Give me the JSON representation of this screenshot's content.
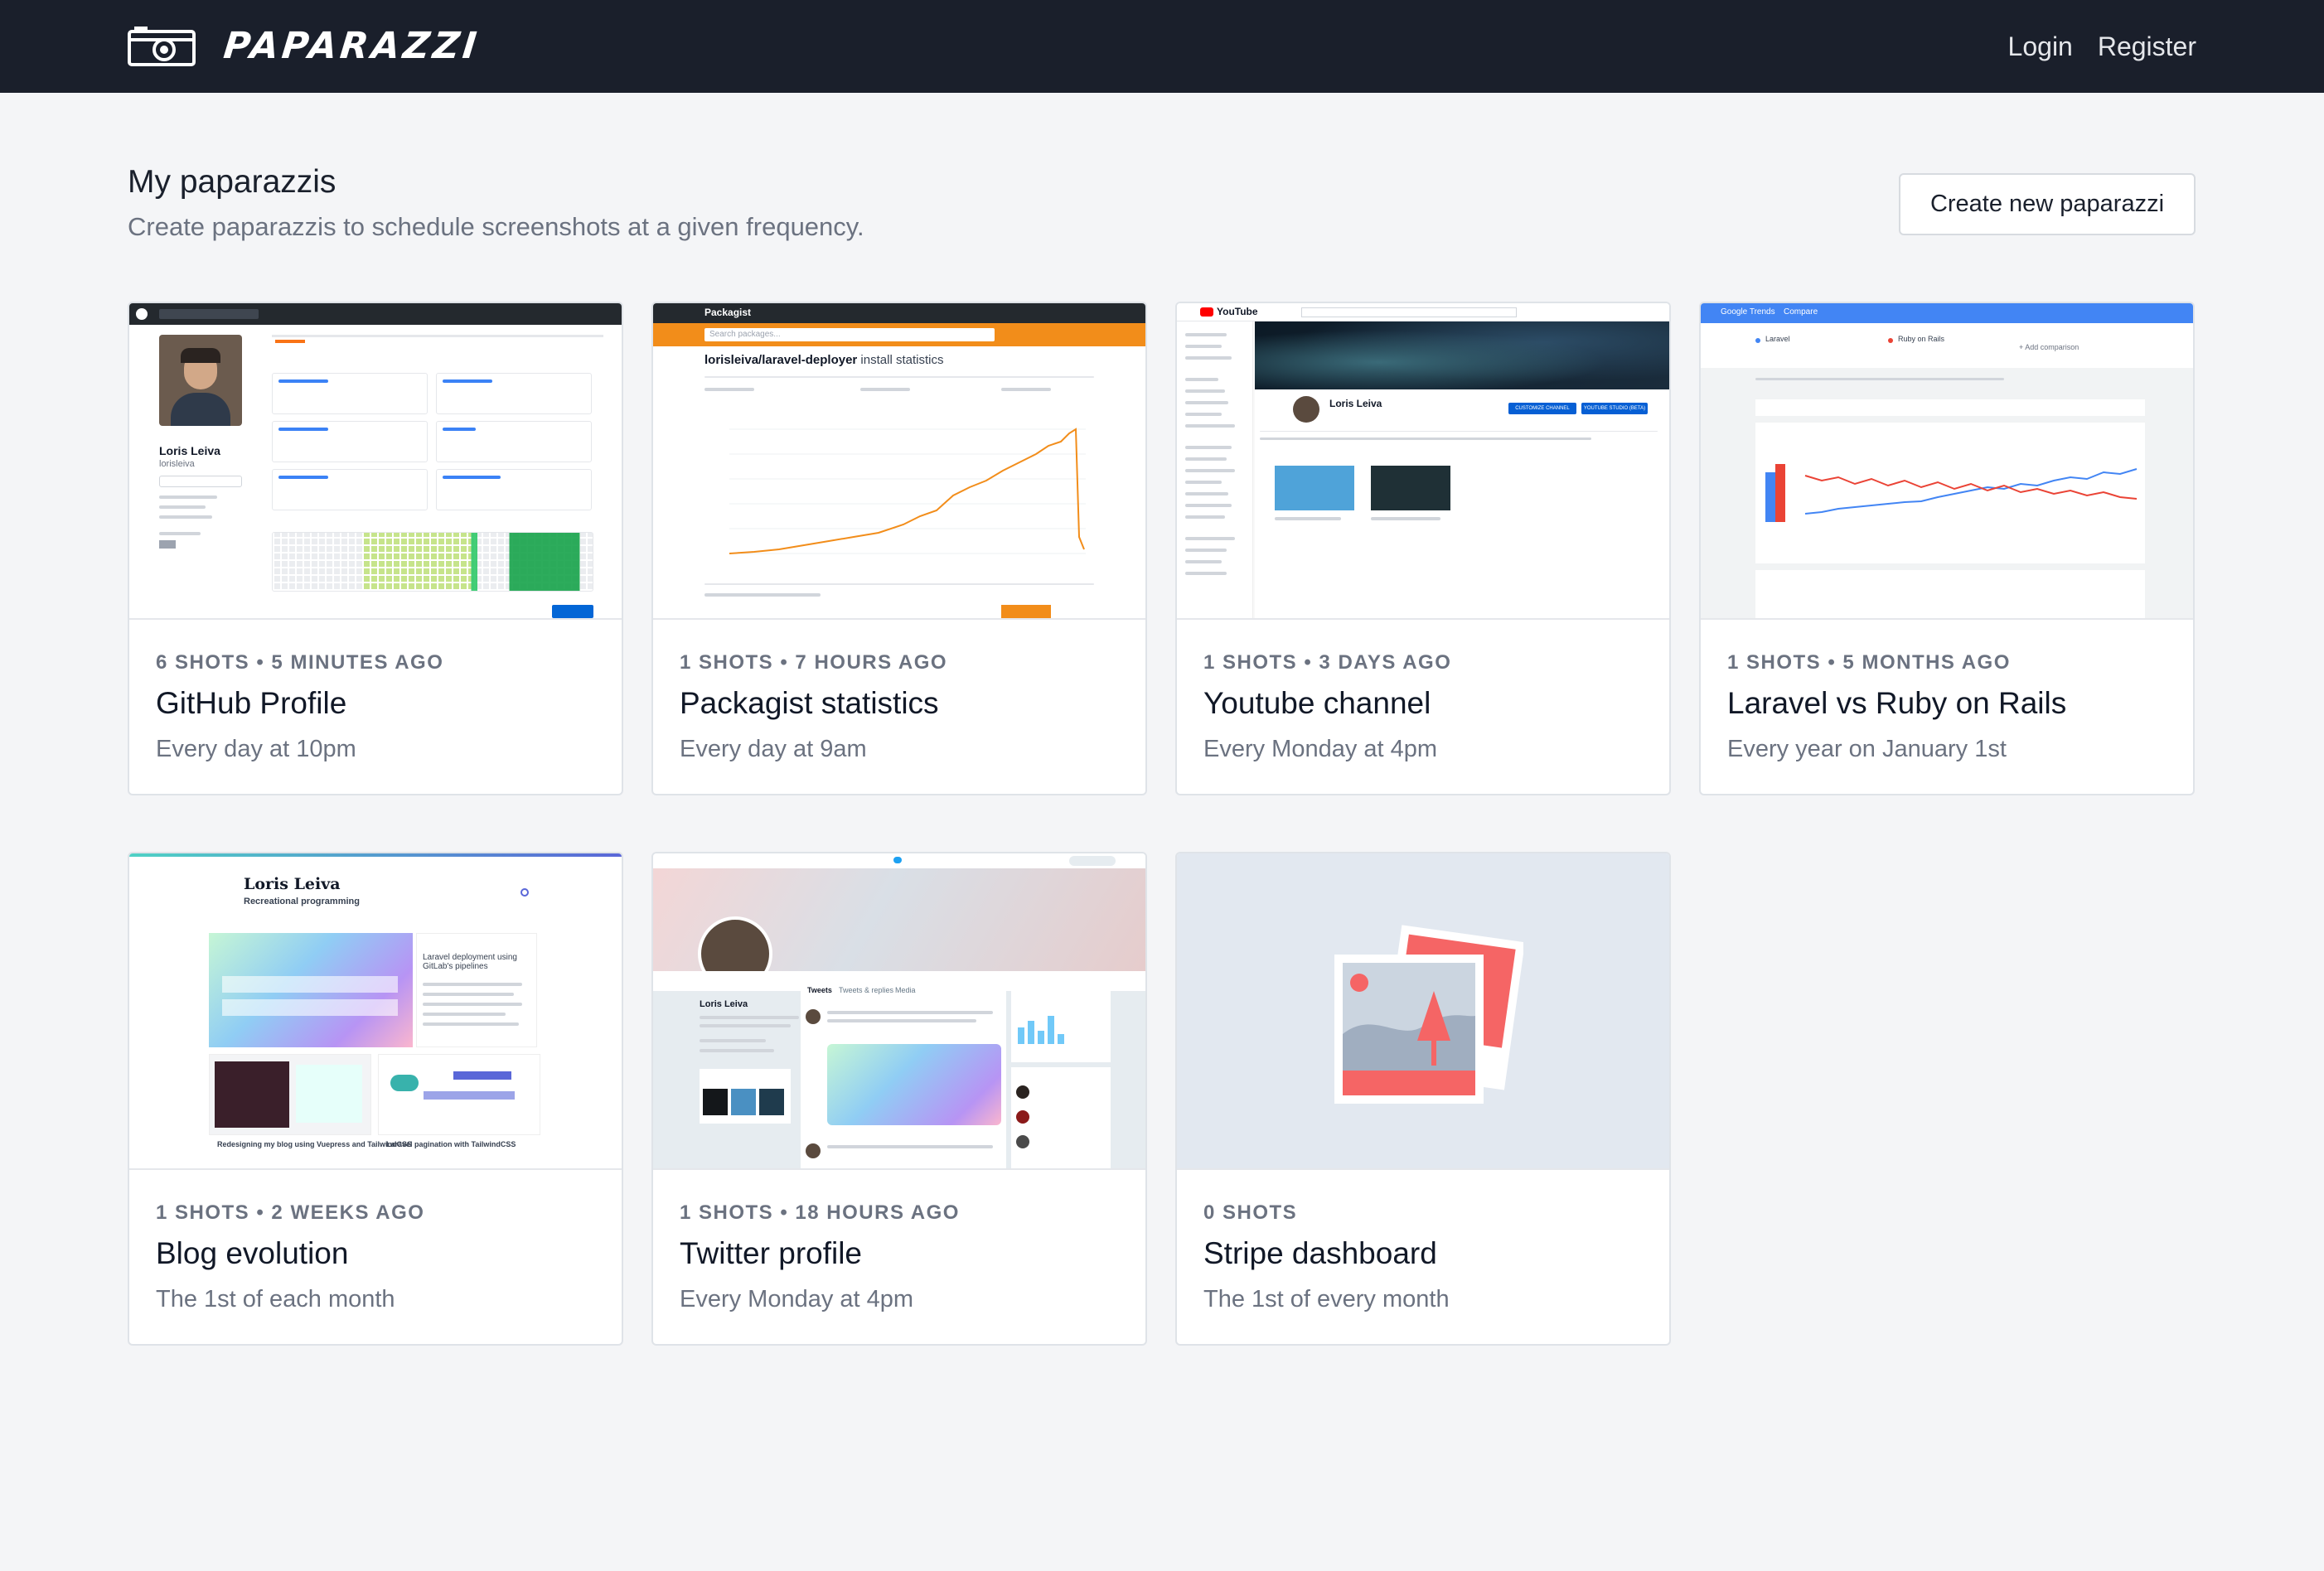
{
  "header": {
    "app_name": "PAPARAZZI",
    "logo_icon": "camera-icon",
    "nav": {
      "login": "Login",
      "register": "Register"
    },
    "background": "#1a1f2b"
  },
  "page": {
    "title": "My paparazzis",
    "subtitle": "Create paparazzis to schedule screenshots at a given frequency.",
    "create_button": "Create new paparazzi"
  },
  "cards": [
    {
      "meta": "6 SHOTS • 5 MINUTES AGO",
      "title": "GitHub Profile",
      "frequency": "Every day at 10pm"
    },
    {
      "meta": "1 SHOTS • 7 HOURS AGO",
      "title": "Packagist statistics",
      "frequency": "Every day at 9am"
    },
    {
      "meta": "1 SHOTS • 3 DAYS AGO",
      "title": "Youtube channel",
      "frequency": "Every Monday at 4pm"
    },
    {
      "meta": "1 SHOTS • 5 MONTHS AGO",
      "title": "Laravel vs Ruby on Rails",
      "frequency": "Every year on January 1st"
    },
    {
      "meta": "1 SHOTS • 2 WEEKS AGO",
      "title": "Blog evolution",
      "frequency": "The 1st of each month"
    },
    {
      "meta": "1 SHOTS • 18 HOURS AGO",
      "title": "Twitter profile",
      "frequency": "Every Monday at 4pm"
    },
    {
      "meta": "0 SHOTS",
      "title": "Stripe dashboard",
      "frequency": "The 1st of every month"
    }
  ],
  "thumbnails": {
    "github": {
      "name": "Loris Leiva",
      "handle": "lorisleiva"
    },
    "packagist": {
      "brand": "Packagist",
      "repo": "lorisleiva/laravel-deployer",
      "suffix": " install statistics",
      "search_placeholder": "Search packages..."
    },
    "youtube": {
      "brand": "YouTube",
      "channel": "Loris Leiva",
      "customize": "CUSTOMIZE CHANNEL",
      "studio": "YOUTUBE STUDIO (BETA)"
    },
    "trends": {
      "brand": "Google Trends",
      "compare": "Compare",
      "term_a": "Laravel",
      "term_b": "Ruby on Rails",
      "add": "+ Add comparison"
    },
    "blog": {
      "name": "Loris Leiva",
      "tagline": "Recreational programming",
      "post_a": "Laravel deployment using GitLab's pipelines",
      "post_b": "Redesigning my blog using Vuepress and TailwindCSS",
      "post_c": "Laravel pagination with TailwindCSS"
    },
    "twitter": {
      "name": "Loris Leiva",
      "tab_tweets": "Tweets",
      "tab_replies": "Tweets & replies",
      "tab_media": "Media"
    },
    "placeholder_icon": "image-placeholder-icon"
  }
}
